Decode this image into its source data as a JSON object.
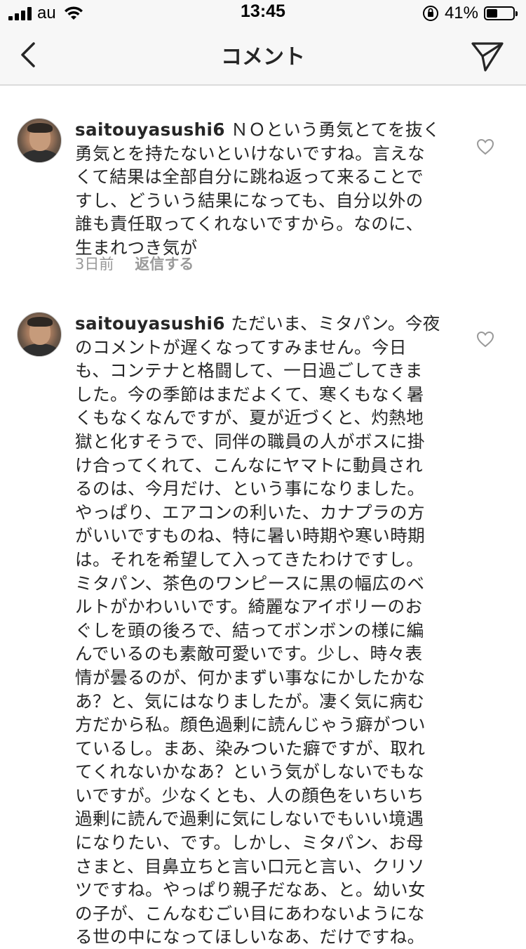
{
  "status_bar": {
    "carrier": "au",
    "time": "13:45",
    "battery_percent": "41%",
    "battery_level": 0.41,
    "icons": [
      "signal-icon",
      "wifi-icon",
      "orientation-lock-icon",
      "battery-icon"
    ]
  },
  "nav": {
    "title": "コメント",
    "back_icon": "chevron-left-icon",
    "share_icon": "send-icon"
  },
  "comments": [
    {
      "username": "saitouyasushi6",
      "lines": [
        "ＮＯという勇気とてを抜く",
        "勇気とを持たないといけないですね。言えな",
        "くて結果は全部自分に跳ね返って来ることで",
        "すし、どういう結果になっても、自分以外の",
        "誰も責任取ってくれないですから。なのに、",
        "生まれつき気が"
      ],
      "time_ago": "3日前",
      "reply_label": "返信する"
    },
    {
      "username": "saitouyasushi6",
      "lines": [
        "ただいま、ミタパン。今夜",
        "のコメントが遅くなってすみません。今日",
        "も、コンテナと格闘して、一日過ごしてきま",
        "した。今の季節はまだよくて、寒くもなく暑",
        "くもなくなんですが、夏が近づくと、灼熱地",
        "獄と化すそうで、同伴の職員の人がボスに掛",
        "け合ってくれて、こんなにヤマトに動員され",
        "るのは、今月だけ、という事になりました。",
        "やっぱり、エアコンの利いた、カナプラの方",
        "がいいですものね、特に暑い時期や寒い時期",
        "は。それを希望して入ってきたわけですし。",
        "ミタパン、茶色のワンピースに黒の幅広のベ",
        "ルトがかわいいです。綺麗なアイボリーのお",
        "ぐしを頭の後ろで、結ってボンボンの様に編",
        "んでいるのも素敵可愛いです。少し、時々表",
        "情が曇るのが、何かまずい事なにかしたかな",
        "あ？と、気にはなりましたが。凄く気に病む",
        "方だから私。顔色過剰に読んじゃう癖がつい",
        "ているし。まあ、染みついた癖ですが、取れ",
        "てくれないかなあ？という気がしないでもな",
        "いですが。少なくとも、人の顔色をいちいち",
        "過剰に読んで過剰に気にしないでもいい境遇",
        "になりたい、です。しかし、ミタパン、お母",
        "さまと、目鼻立ちと言い口元と言い、クリソ",
        "ツですね。やっぱり親子だなあ、と。幼い女",
        "の子が、こんなむごい目にあわないようにな",
        "る世の中になってほしいなあ、だけですね。"
      ]
    }
  ]
}
